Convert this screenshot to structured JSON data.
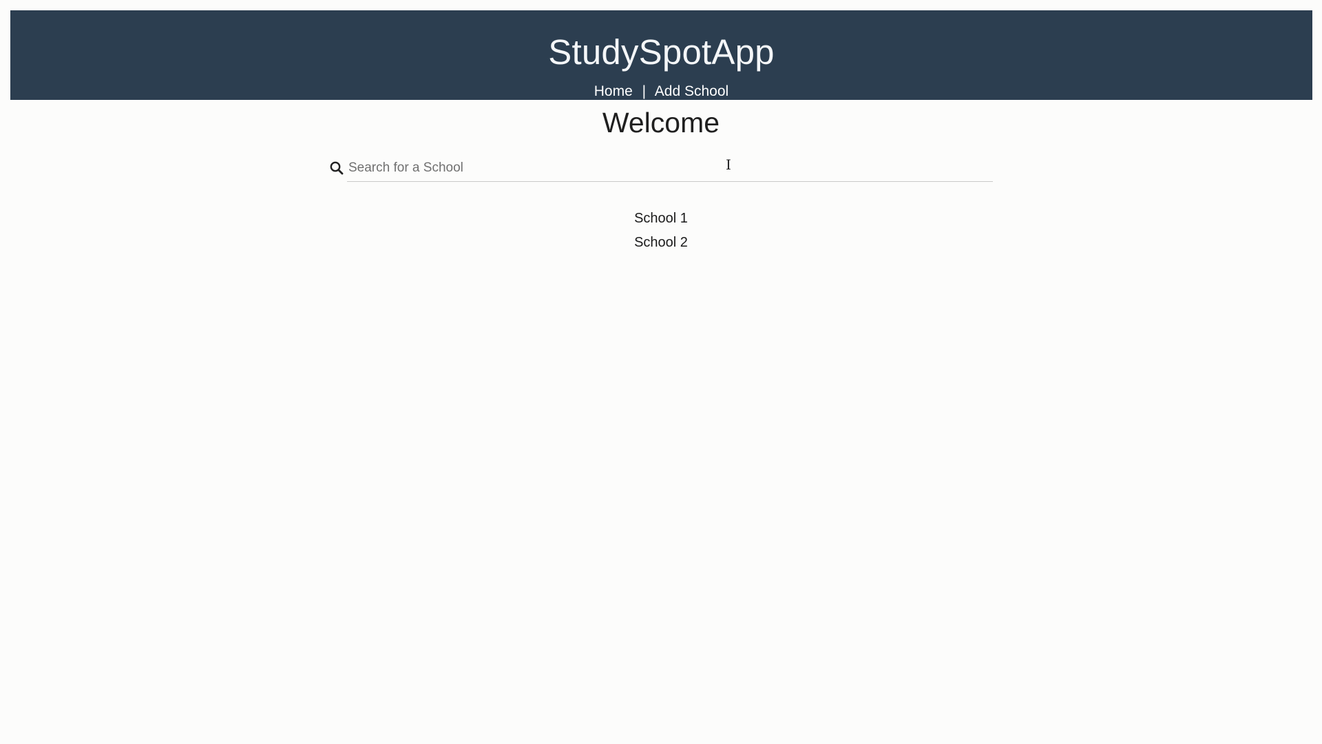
{
  "header": {
    "title": "StudySpotApp",
    "nav": {
      "home_label": "Home",
      "separator": "|",
      "add_school_label": "Add School"
    }
  },
  "main": {
    "heading": "Welcome",
    "search": {
      "placeholder": "Search for a School",
      "value": "",
      "icon": "search-icon"
    },
    "schools": [
      {
        "name": "School 1"
      },
      {
        "name": "School 2"
      }
    ]
  },
  "colors": {
    "header_background": "#2c3e50",
    "page_background": "#fcfcfb",
    "header_text": "#ffffff"
  }
}
